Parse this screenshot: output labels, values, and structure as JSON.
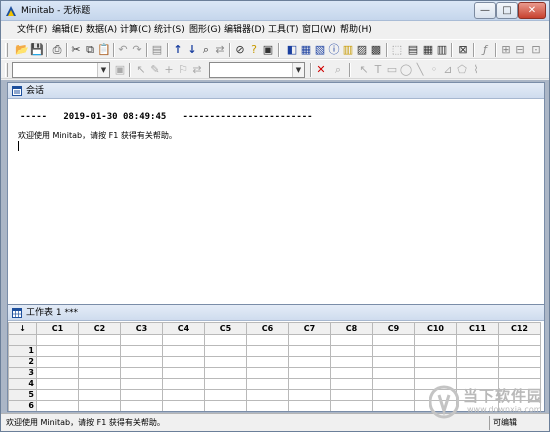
{
  "window": {
    "title": "Minitab - 无标题",
    "minimize": "—",
    "maximize": "□",
    "close": "✕"
  },
  "menu": [
    "文件(F)",
    "编辑(E)",
    "数据(A)",
    "计算(C)",
    "统计(S)",
    "图形(G)",
    "编辑器(D)",
    "工具(T)",
    "窗口(W)",
    "帮助(H)"
  ],
  "session": {
    "title": "会话",
    "separator": "-----   2019-01-30 08:49:45   ------------------------",
    "welcome": "欢迎使用 Minitab，请按 F1 获得有关帮助。"
  },
  "worksheet": {
    "title": "工作表 1 ***",
    "corner": "↓",
    "columns": [
      "C1",
      "C2",
      "C3",
      "C4",
      "C5",
      "C6",
      "C7",
      "C8",
      "C9",
      "C10",
      "C11",
      "C12"
    ],
    "rows": [
      "",
      "1",
      "2",
      "3",
      "4",
      "5",
      "6"
    ]
  },
  "status": {
    "message": "欢迎使用 Minitab，请按 F1 获得有关帮助。",
    "mode": "可编辑"
  },
  "watermark": {
    "text": "当下软件园",
    "url": "www.downxia.com"
  },
  "colors": {
    "titlebar": "#c5d6ec",
    "workspace": "#abb6c6",
    "close": "#c7412f"
  }
}
